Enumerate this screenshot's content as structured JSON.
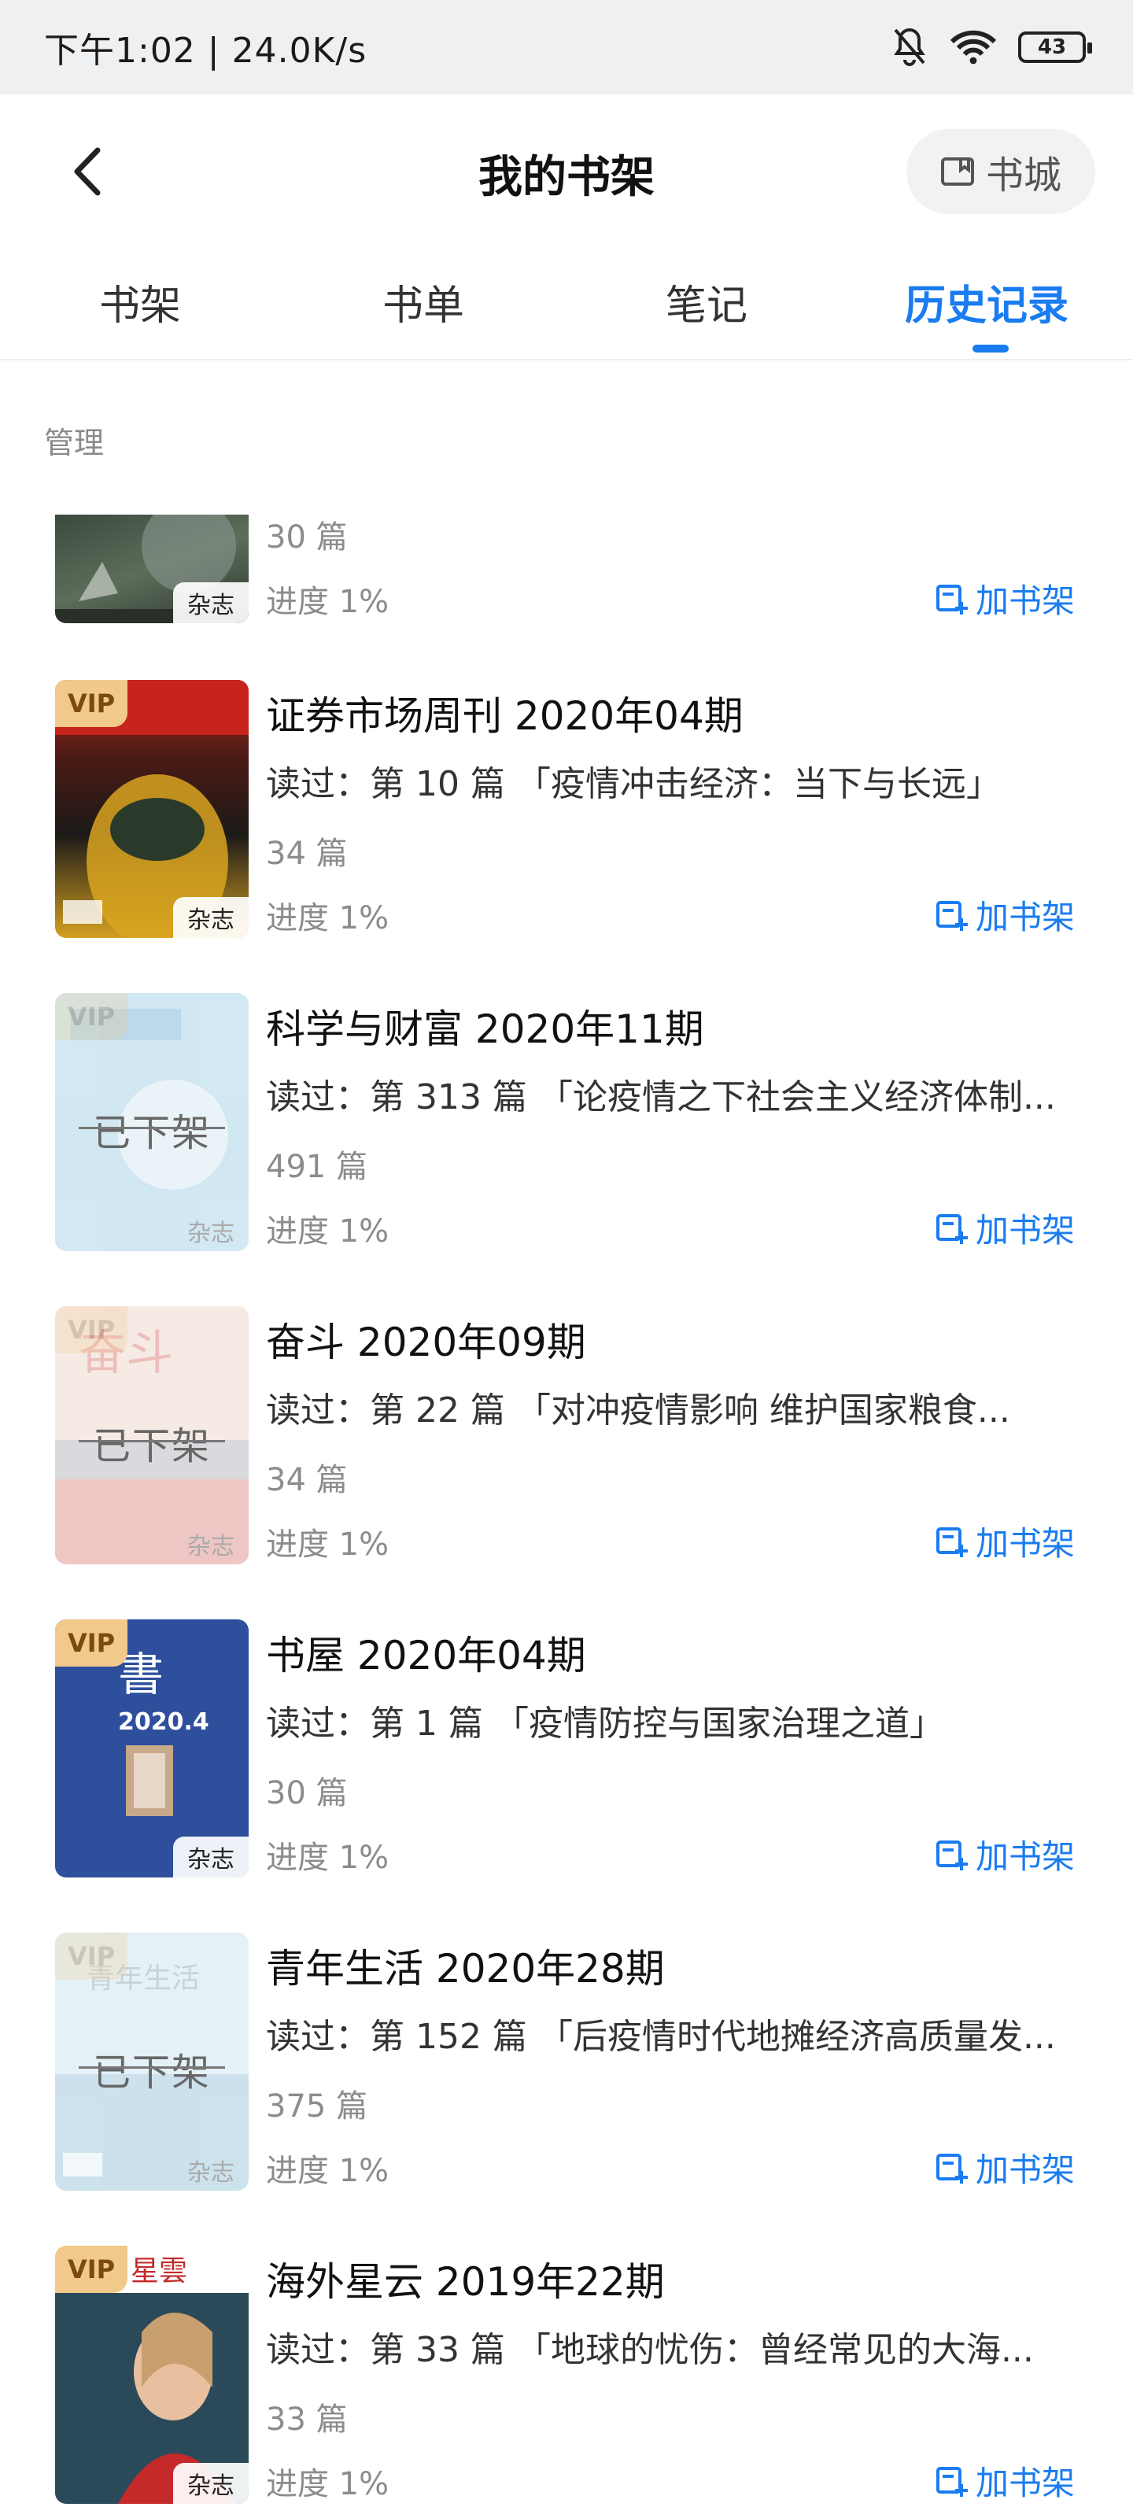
{
  "status_bar": {
    "time_speed": "下午1:02 | 24.0K/s",
    "battery": "43"
  },
  "header": {
    "title": "我的书架",
    "store_label": "书城"
  },
  "tabs": [
    {
      "label": "书架"
    },
    {
      "label": "书单"
    },
    {
      "label": "笔记"
    },
    {
      "label": "历史记录",
      "active": true
    }
  ],
  "manage_label": "管理",
  "add_label": "加书架",
  "vip_label": "VIP",
  "magazine_tag": "杂志",
  "offshelf_label": "已下架",
  "items": [
    {
      "title": "",
      "read": "",
      "count": "30 篇",
      "progress": "进度 1%"
    },
    {
      "title": "证券市场周刊  2020年04期",
      "read": "读过：第 10 篇 「疫情冲击经济：当下与长远」",
      "count": "34 篇",
      "progress": "进度 1%"
    },
    {
      "title": "科学与财富  2020年11期",
      "read": "读过：第 313 篇 「论疫情之下社会主义经济体制...",
      "count": "491 篇",
      "progress": "进度 1%"
    },
    {
      "title": "奋斗  2020年09期",
      "read": "读过：第 22 篇 「对冲疫情影响  维护国家粮食...",
      "count": "34 篇",
      "progress": "进度 1%"
    },
    {
      "title": "书屋  2020年04期",
      "read": "读过：第 1 篇 「疫情防控与国家治理之道」",
      "count": "30 篇",
      "progress": "进度 1%"
    },
    {
      "title": "青年生活  2020年28期",
      "read": "读过：第 152 篇 「后疫情时代地摊经济高质量发...",
      "count": "375 篇",
      "progress": "进度 1%"
    },
    {
      "title": "海外星云  2019年22期",
      "read": "读过：第 33 篇 「地球的忧伤：曾经常见的大海...",
      "count": "33 篇",
      "progress": "进度 1%"
    }
  ],
  "colors": {
    "accent": "#1a7cf0",
    "vip_bg": "#f1c98a"
  }
}
